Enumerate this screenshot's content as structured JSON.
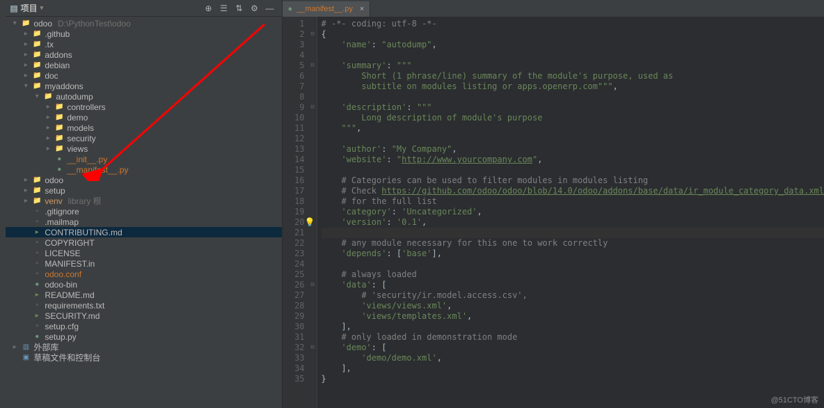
{
  "panel": {
    "title": "项目"
  },
  "toolbar_icons": [
    "target-icon",
    "focus-icon",
    "collapse-icon",
    "hide-icon",
    "gear-icon",
    "minimize-icon"
  ],
  "tree": [
    {
      "indent": 0,
      "chev": "v",
      "type": "folder",
      "name": "odoo",
      "muted": "D:\\PythonTest\\odoo"
    },
    {
      "indent": 1,
      "chev": ">",
      "type": "folder",
      "name": ".github"
    },
    {
      "indent": 1,
      "chev": ">",
      "type": "folder",
      "name": ".tx"
    },
    {
      "indent": 1,
      "chev": ">",
      "type": "folder",
      "name": "addons"
    },
    {
      "indent": 1,
      "chev": ">",
      "type": "folder",
      "name": "debian"
    },
    {
      "indent": 1,
      "chev": ">",
      "type": "folder",
      "name": "doc"
    },
    {
      "indent": 1,
      "chev": "v",
      "type": "folder",
      "name": "myaddons"
    },
    {
      "indent": 2,
      "chev": "v",
      "type": "folder",
      "name": "autodump"
    },
    {
      "indent": 3,
      "chev": ">",
      "type": "folder",
      "name": "controllers"
    },
    {
      "indent": 3,
      "chev": ">",
      "type": "folder",
      "name": "demo"
    },
    {
      "indent": 3,
      "chev": ">",
      "type": "folder",
      "name": "models"
    },
    {
      "indent": 3,
      "chev": ">",
      "type": "folder",
      "name": "security"
    },
    {
      "indent": 3,
      "chev": ">",
      "type": "folder",
      "name": "views"
    },
    {
      "indent": 3,
      "chev": " ",
      "type": "py",
      "name": "__init__.py",
      "class": "orange"
    },
    {
      "indent": 3,
      "chev": " ",
      "type": "py",
      "name": "__manifest__.py",
      "class": "orange"
    },
    {
      "indent": 1,
      "chev": ">",
      "type": "folder",
      "name": "odoo"
    },
    {
      "indent": 1,
      "chev": ">",
      "type": "folder",
      "name": "setup"
    },
    {
      "indent": 1,
      "chev": ">",
      "type": "folder",
      "name": "venv",
      "muted": "library 根",
      "class": "highlight"
    },
    {
      "indent": 1,
      "chev": " ",
      "type": "file",
      "name": ".gitignore"
    },
    {
      "indent": 1,
      "chev": " ",
      "type": "file",
      "name": ".mailmap"
    },
    {
      "indent": 1,
      "chev": " ",
      "type": "md",
      "name": "CONTRIBUTING.md",
      "sel": true
    },
    {
      "indent": 1,
      "chev": " ",
      "type": "file",
      "name": "COPYRIGHT"
    },
    {
      "indent": 1,
      "chev": " ",
      "type": "file",
      "name": "LICENSE"
    },
    {
      "indent": 1,
      "chev": " ",
      "type": "file",
      "name": "MANIFEST.in"
    },
    {
      "indent": 1,
      "chev": " ",
      "type": "file",
      "name": "odoo.conf",
      "class": "orange"
    },
    {
      "indent": 1,
      "chev": " ",
      "type": "py",
      "name": "odoo-bin"
    },
    {
      "indent": 1,
      "chev": " ",
      "type": "md",
      "name": "README.md"
    },
    {
      "indent": 1,
      "chev": " ",
      "type": "file",
      "name": "requirements.txt"
    },
    {
      "indent": 1,
      "chev": " ",
      "type": "md",
      "name": "SECURITY.md"
    },
    {
      "indent": 1,
      "chev": " ",
      "type": "file",
      "name": "setup.cfg"
    },
    {
      "indent": 1,
      "chev": " ",
      "type": "py",
      "name": "setup.py"
    },
    {
      "indent": 0,
      "chev": ">",
      "type": "lib",
      "name": "外部库"
    },
    {
      "indent": 0,
      "chev": " ",
      "type": "scratch",
      "name": "草稿文件和控制台"
    }
  ],
  "tab": {
    "filename": "__manifest__.py"
  },
  "code_lines": [
    {
      "n": 1,
      "fold": "",
      "html": "<span class='cmt'># -*- coding: utf-8 -*-</span>"
    },
    {
      "n": 2,
      "fold": "⊟",
      "html": "<span class='punc'>{</span>"
    },
    {
      "n": 3,
      "fold": "",
      "html": "    <span class='str'>'name'</span><span class='punc'>: </span><span class='str'>\"autodump\"</span><span class='punc'>,</span>"
    },
    {
      "n": 4,
      "fold": "",
      "html": ""
    },
    {
      "n": 5,
      "fold": "⊟",
      "html": "    <span class='str'>'summary'</span><span class='punc'>: </span><span class='str'>\"\"\"</span>"
    },
    {
      "n": 6,
      "fold": "",
      "html": "<span class='str'>        Short (1 phrase/line) summary of the module's purpose, used as</span>"
    },
    {
      "n": 7,
      "fold": "",
      "html": "<span class='str'>        subtitle on modules listing or apps.openerp.com\"\"\"</span><span class='punc'>,</span>"
    },
    {
      "n": 8,
      "fold": "",
      "html": ""
    },
    {
      "n": 9,
      "fold": "⊟",
      "html": "    <span class='str'>'description'</span><span class='punc'>: </span><span class='str'>\"\"\"</span>"
    },
    {
      "n": 10,
      "fold": "",
      "html": "<span class='str'>        Long description of module's purpose</span>"
    },
    {
      "n": 11,
      "fold": "",
      "html": "<span class='str'>    \"\"\"</span><span class='punc'>,</span>"
    },
    {
      "n": 12,
      "fold": "",
      "html": ""
    },
    {
      "n": 13,
      "fold": "",
      "html": "    <span class='str'>'author'</span><span class='punc'>: </span><span class='str'>\"My Company\"</span><span class='punc'>,</span>"
    },
    {
      "n": 14,
      "fold": "",
      "html": "    <span class='str'>'website'</span><span class='punc'>: </span><span class='str'>\"</span><span class='lnk'>http://www.yourcompany.com</span><span class='str'>\"</span><span class='punc'>,</span>"
    },
    {
      "n": 15,
      "fold": "",
      "html": ""
    },
    {
      "n": 16,
      "fold": "",
      "html": "    <span class='cmt'># Categories can be used to filter modules in modules listing</span>"
    },
    {
      "n": 17,
      "fold": "",
      "html": "    <span class='cmt'># Check </span><span class='lnk'>https://github.com/odoo/odoo/blob/14.0/odoo/addons/base/data/ir_module_category_data.xml</span>"
    },
    {
      "n": 18,
      "fold": "",
      "html": "    <span class='cmt'># for the full list</span>"
    },
    {
      "n": 19,
      "fold": "",
      "html": "    <span class='str'>'category'</span><span class='punc'>: </span><span class='str'>'Uncategorized'</span><span class='punc'>,</span>"
    },
    {
      "n": 20,
      "fold": "",
      "html": "    <span class='str'>'version'</span><span class='punc'>: </span><span class='str'>'0.1'</span><span class='punc'>,</span>",
      "bulb": true
    },
    {
      "n": 21,
      "fold": "",
      "html": "",
      "active": true
    },
    {
      "n": 22,
      "fold": "",
      "html": "    <span class='cmt'># any module necessary for this one to work correctly</span>"
    },
    {
      "n": 23,
      "fold": "",
      "html": "    <span class='str'>'depends'</span><span class='punc'>: [</span><span class='str'>'base'</span><span class='punc'>],</span>"
    },
    {
      "n": 24,
      "fold": "",
      "html": ""
    },
    {
      "n": 25,
      "fold": "",
      "html": "    <span class='cmt'># always loaded</span>"
    },
    {
      "n": 26,
      "fold": "⊟",
      "html": "    <span class='str'>'data'</span><span class='punc'>: [</span>"
    },
    {
      "n": 27,
      "fold": "",
      "html": "        <span class='cmt'># 'security/ir.model.access.csv',</span>"
    },
    {
      "n": 28,
      "fold": "",
      "html": "        <span class='str'>'views/views.xml'</span><span class='punc'>,</span>"
    },
    {
      "n": 29,
      "fold": "",
      "html": "        <span class='str'>'views/templates.xml'</span><span class='punc'>,</span>"
    },
    {
      "n": 30,
      "fold": "",
      "html": "    <span class='punc'>],</span>"
    },
    {
      "n": 31,
      "fold": "",
      "html": "    <span class='cmt'># only loaded in demonstration mode</span>"
    },
    {
      "n": 32,
      "fold": "⊟",
      "html": "    <span class='str'>'demo'</span><span class='punc'>: [</span>"
    },
    {
      "n": 33,
      "fold": "",
      "html": "        <span class='str'>'demo/demo.xml'</span><span class='punc'>,</span>"
    },
    {
      "n": 34,
      "fold": "",
      "html": "    <span class='punc'>],</span>"
    },
    {
      "n": 35,
      "fold": "",
      "html": "<span class='punc'>}</span>"
    }
  ],
  "watermark": "@51CTO博客"
}
